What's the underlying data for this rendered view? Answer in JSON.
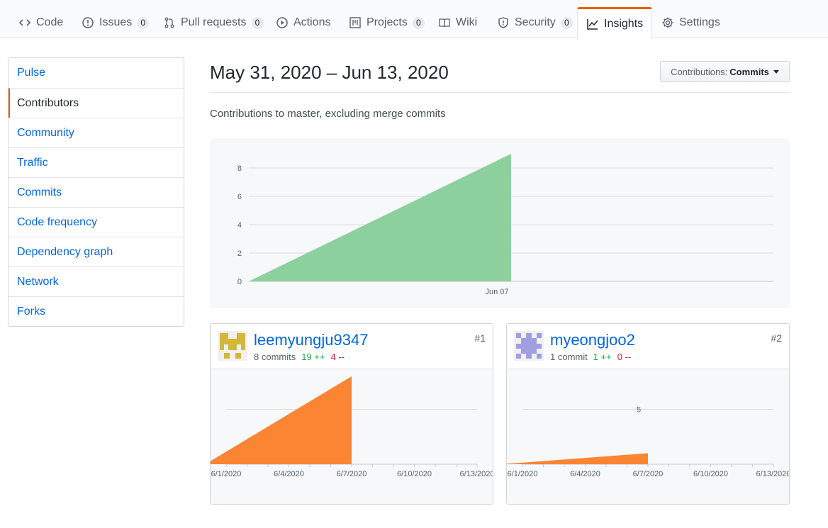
{
  "nav": {
    "tabs": [
      {
        "label": "Code",
        "icon": "code-icon"
      },
      {
        "label": "Issues",
        "count": "0",
        "icon": "issue-icon"
      },
      {
        "label": "Pull requests",
        "count": "0",
        "icon": "pull-request-icon"
      },
      {
        "label": "Actions",
        "icon": "play-icon"
      },
      {
        "label": "Projects",
        "count": "0",
        "icon": "project-icon"
      },
      {
        "label": "Wiki",
        "icon": "book-icon"
      },
      {
        "label": "Security",
        "count": "0",
        "icon": "shield-icon"
      },
      {
        "label": "Insights",
        "icon": "graph-icon",
        "selected": true
      },
      {
        "label": "Settings",
        "icon": "gear-icon"
      }
    ]
  },
  "sidebar": {
    "items": [
      {
        "label": "Pulse"
      },
      {
        "label": "Contributors",
        "selected": true
      },
      {
        "label": "Community"
      },
      {
        "label": "Traffic"
      },
      {
        "label": "Commits"
      },
      {
        "label": "Code frequency"
      },
      {
        "label": "Dependency graph"
      },
      {
        "label": "Network"
      },
      {
        "label": "Forks"
      }
    ]
  },
  "header": {
    "date_range": "May 31, 2020 – Jun 13, 2020",
    "select_label": "Contributions:",
    "select_value": "Commits",
    "subtitle": "Contributions to master, excluding merge commits"
  },
  "colors": {
    "accent": "#e36209",
    "link": "#0366d6",
    "main_area": "#8cd09d",
    "contrib_area": "#fb8532",
    "additions": "#28a745",
    "deletions": "#cb2431"
  },
  "chart_data": [
    {
      "type": "area",
      "x": [
        "2020-05-31",
        "2020-06-07"
      ],
      "values": [
        0,
        9
      ],
      "x_ticks": [
        "Jun 07"
      ],
      "y_ticks": [
        0,
        2,
        4,
        6,
        8
      ],
      "ylim": [
        0,
        9
      ],
      "xlim": [
        "2020-05-31",
        "2020-06-14"
      ],
      "grid": true
    },
    {
      "type": "area",
      "x": [
        "2020-05-31",
        "2020-06-07"
      ],
      "values": [
        0,
        8
      ],
      "x_ticks": [
        "6/1/2020",
        "6/4/2020",
        "6/7/2020",
        "6/10/2020",
        "6/13/2020"
      ],
      "ylim": [
        0,
        8
      ],
      "grid": true
    },
    {
      "type": "area",
      "x": [
        "2020-05-31",
        "2020-06-07"
      ],
      "values": [
        0,
        1
      ],
      "x_ticks": [
        "6/1/2020",
        "6/4/2020",
        "6/7/2020",
        "6/10/2020",
        "6/13/2020"
      ],
      "y_ticks": [
        5
      ],
      "ylim": [
        0,
        8
      ],
      "grid": true
    }
  ],
  "contributors": [
    {
      "username": "leemyungju9347",
      "commits": "8 commits",
      "additions": "19 ++",
      "deletions": "4 --",
      "rank": "#1",
      "avatar_color": "#d4b73a"
    },
    {
      "username": "myeongjoo2",
      "commits": "1 commit",
      "additions": "1 ++",
      "deletions": "0 --",
      "rank": "#2",
      "avatar_color": "#9e9ee0"
    }
  ]
}
